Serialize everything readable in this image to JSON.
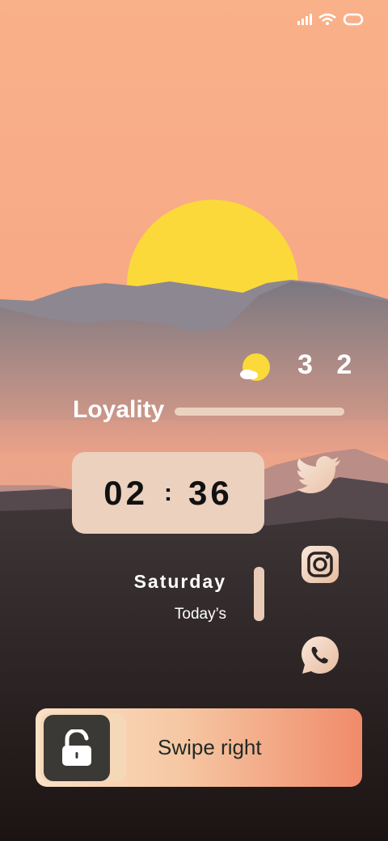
{
  "status_bar": {
    "icons": [
      "signal-icon",
      "wifi-icon",
      "battery-icon"
    ]
  },
  "weather": {
    "icon": "sun-cloud-icon",
    "temperature": "3 2"
  },
  "widget": {
    "brand_label": "Loyality"
  },
  "clock": {
    "hours": "02",
    "separator": ":",
    "minutes": "36"
  },
  "date": {
    "day": "Saturday",
    "subtitle": "Today’s"
  },
  "apps": [
    "twitter-icon",
    "instagram-icon",
    "whatsapp-icon"
  ],
  "unlock": {
    "label": "Swipe right",
    "icon": "unlock-icon"
  },
  "colors": {
    "sky_top": "#f9b189",
    "accent_beige": "#ebd1be",
    "swipe_end": "#f08b6a",
    "sun": "#fbd93a"
  }
}
